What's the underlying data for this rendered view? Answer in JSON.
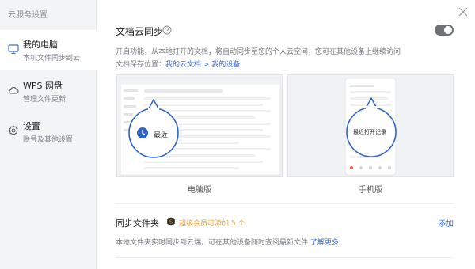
{
  "sidebar": {
    "title": "云服务设置",
    "items": [
      {
        "label": "我的电脑",
        "sub": "本机文件同步到云"
      },
      {
        "label": "WPS 网盘",
        "sub": "管理文件更新"
      },
      {
        "label": "设置",
        "sub": "账号及其他设置"
      }
    ]
  },
  "main": {
    "section_title": "文档云同步",
    "toggle_on": false,
    "description": "开启功能，从本地打开的文档，将自动同步至您的个人云空间，您可在其他设备上继续访问",
    "path_prefix": "文档保存位置：",
    "path_link": "我的云文档 > 我的设备",
    "preview_desktop_bubble": "最近",
    "preview_mobile_bubble": "最近打开记录",
    "caption_desktop": "电脑版",
    "caption_mobile": "手机版",
    "sync_title": "同步文件夹",
    "vip_text": "超级会员可添加 5 个",
    "add_label": "添加",
    "sync_desc": "本地文件夹实时同步到云端，可在其他设备随时查阅最新文件",
    "learn_more": "了解更多"
  },
  "colors": {
    "accent": "#3b6fd1",
    "vip": "#e4a13a",
    "toggle_off": "#6e7276",
    "sidebar_bg": "#f3f4f6"
  }
}
